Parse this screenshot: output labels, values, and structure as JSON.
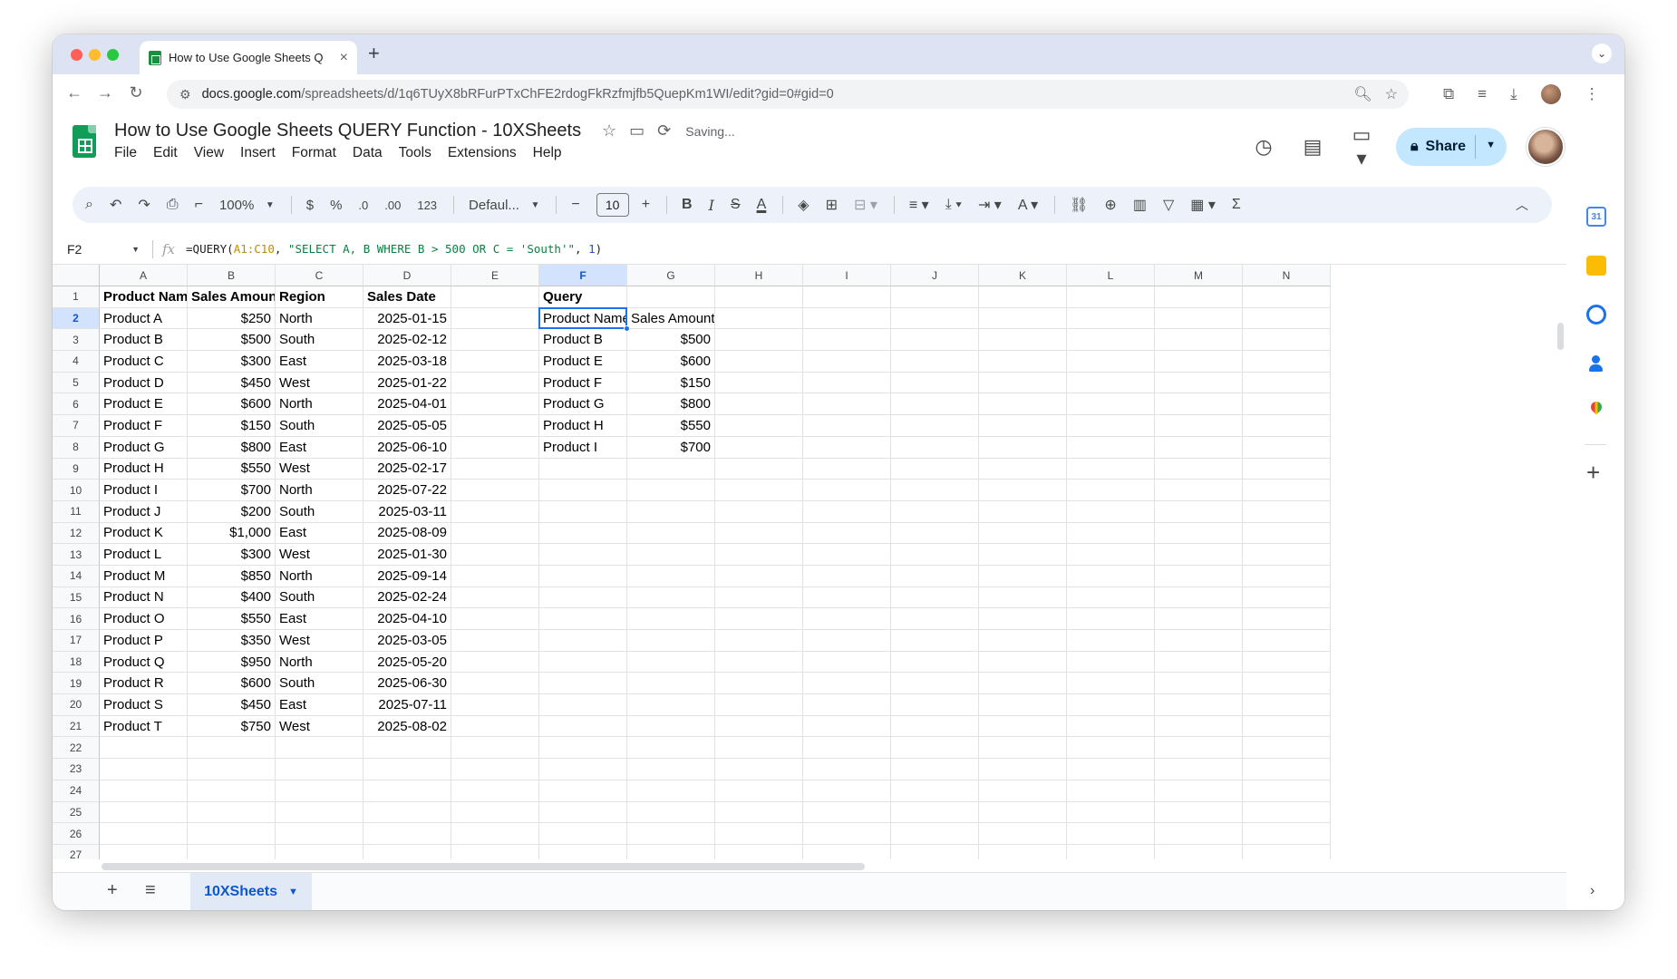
{
  "browser": {
    "tab_title": "How to Use Google Sheets Q",
    "new_tab": "+",
    "tab_close": "×",
    "url_host": "docs.google.com",
    "url_path": "/spreadsheets/d/1q6TUyX8bRFurPTxChFE2rdogFkRzfmjfb5QuepKm1WI/edit?gid=0#gid=0"
  },
  "doc": {
    "title": "How to Use Google Sheets QUERY Function - 10XSheets",
    "status": "Saving...",
    "share_label": "Share"
  },
  "menu": [
    "File",
    "Edit",
    "View",
    "Insert",
    "Format",
    "Data",
    "Tools",
    "Extensions",
    "Help"
  ],
  "toolbar": {
    "zoom": "100%",
    "currency": "$",
    "percent": "%",
    "dec_decrease": ".0",
    "dec_increase": ".00",
    "number_format": "123",
    "font": "Defaul...",
    "font_size": "10",
    "bold": "B",
    "italic": "I",
    "strike": "S",
    "text_color": "A",
    "sum": "Σ"
  },
  "formula_bar": {
    "cell_ref": "F2",
    "fx": "fx",
    "f_open": "=QUERY(",
    "f_range": "A1:C10",
    "f_sep": ", ",
    "f_query": "\"SELECT A, B WHERE B > 500 OR C = 'South'\"",
    "f_sep2": ", ",
    "f_headers": "1",
    "f_close": ")"
  },
  "grid": {
    "columns": [
      "A",
      "B",
      "C",
      "D",
      "E",
      "F",
      "G",
      "H",
      "I",
      "J",
      "K",
      "L",
      "M",
      "N"
    ],
    "selected_column": "F",
    "selected_row": "2",
    "row_numbers": [
      "1",
      "2",
      "3",
      "4",
      "5",
      "6",
      "7",
      "8",
      "9",
      "10",
      "11",
      "12",
      "13",
      "14",
      "15",
      "16",
      "17",
      "18",
      "19",
      "20",
      "21",
      "22",
      "23",
      "24",
      "25",
      "26",
      "27"
    ],
    "rows": [
      [
        "Product Name",
        "Sales Amount",
        "Region",
        "Sales Date",
        "",
        "Query",
        ""
      ],
      [
        "Product A",
        "$250",
        "North",
        "2025-01-15",
        "",
        "Product Name",
        "Sales Amount"
      ],
      [
        "Product B",
        "$500",
        "South",
        "2025-02-12",
        "",
        "Product B",
        "$500"
      ],
      [
        "Product C",
        "$300",
        "East",
        "2025-03-18",
        "",
        "Product E",
        "$600"
      ],
      [
        "Product D",
        "$450",
        "West",
        "2025-01-22",
        "",
        "Product F",
        "$150"
      ],
      [
        "Product E",
        "$600",
        "North",
        "2025-04-01",
        "",
        "Product G",
        "$800"
      ],
      [
        "Product F",
        "$150",
        "South",
        "2025-05-05",
        "",
        "Product H",
        "$550"
      ],
      [
        "Product G",
        "$800",
        "East",
        "2025-06-10",
        "",
        "Product I",
        "$700"
      ],
      [
        "Product H",
        "$550",
        "West",
        "2025-02-17",
        "",
        "",
        ""
      ],
      [
        "Product I",
        "$700",
        "North",
        "2025-07-22",
        "",
        "",
        ""
      ],
      [
        "Product J",
        "$200",
        "South",
        "2025-03-11",
        "",
        "",
        ""
      ],
      [
        "Product K",
        "$1,000",
        "East",
        "2025-08-09",
        "",
        "",
        ""
      ],
      [
        "Product L",
        "$300",
        "West",
        "2025-01-30",
        "",
        "",
        ""
      ],
      [
        "Product M",
        "$850",
        "North",
        "2025-09-14",
        "",
        "",
        ""
      ],
      [
        "Product N",
        "$400",
        "South",
        "2025-02-24",
        "",
        "",
        ""
      ],
      [
        "Product O",
        "$550",
        "East",
        "2025-04-10",
        "",
        "",
        ""
      ],
      [
        "Product P",
        "$350",
        "West",
        "2025-03-05",
        "",
        "",
        ""
      ],
      [
        "Product Q",
        "$950",
        "North",
        "2025-05-20",
        "",
        "",
        ""
      ],
      [
        "Product R",
        "$600",
        "South",
        "2025-06-30",
        "",
        "",
        ""
      ],
      [
        "Product S",
        "$450",
        "East",
        "2025-07-11",
        "",
        "",
        ""
      ],
      [
        "Product T",
        "$750",
        "West",
        "2025-08-02",
        "",
        "",
        ""
      ]
    ]
  },
  "sheets": {
    "add": "+",
    "list": "≡",
    "active_tab": "10XSheets"
  },
  "side_panel": {
    "calendar_day": "31",
    "add": "+"
  }
}
